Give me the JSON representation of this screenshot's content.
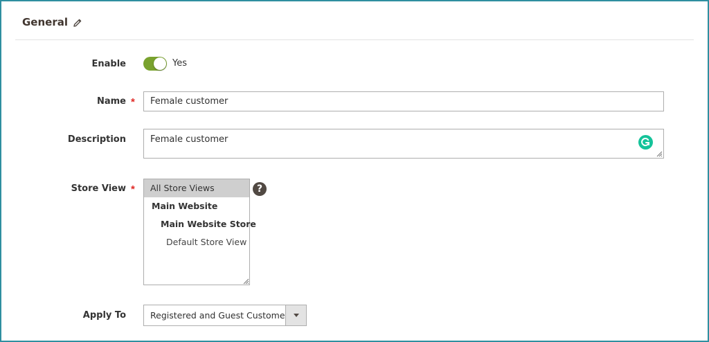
{
  "section": {
    "title": "General",
    "edit_icon": "pencil-icon"
  },
  "fields": {
    "enable": {
      "label": "Enable",
      "value_text": "Yes",
      "on": true,
      "color": "#79a22e"
    },
    "name": {
      "label": "Name",
      "required_mark": "*",
      "value": "Female customer"
    },
    "description": {
      "label": "Description",
      "value": "Female customer",
      "extension_icon": "grammarly-icon"
    },
    "store_view": {
      "label": "Store View",
      "required_mark": "*",
      "options": [
        {
          "label": "All Store Views",
          "selected": true
        },
        {
          "label": "Main Website"
        },
        {
          "label": "Main Website Store"
        },
        {
          "label": "Default Store View"
        }
      ],
      "help_text": "?"
    },
    "apply_to": {
      "label": "Apply To",
      "value": "Registered and Guest Customers"
    }
  },
  "colors": {
    "frame": "#2f8fa0",
    "required": "#e02b27",
    "help": "#514943"
  }
}
